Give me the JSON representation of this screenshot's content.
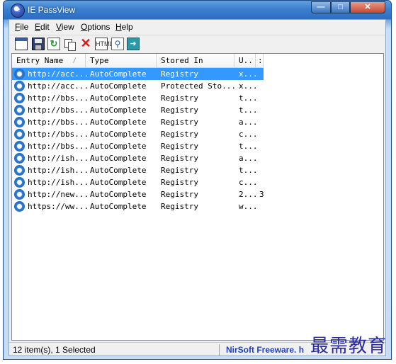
{
  "window": {
    "title": "IE PassView",
    "app_icon_text": "IE"
  },
  "menu": [
    {
      "label": "File",
      "underline": "F",
      "rest": "ile"
    },
    {
      "label": "Edit",
      "underline": "E",
      "rest": "dit"
    },
    {
      "label": "View",
      "underline": "V",
      "rest": "iew"
    },
    {
      "label": "Options",
      "underline": "O",
      "rest": "ptions"
    },
    {
      "label": "Help",
      "underline": "H",
      "rest": "elp"
    }
  ],
  "toolbar": {
    "icons": [
      "properties-icon",
      "save-icon",
      "refresh-icon",
      "copy-icon",
      "delete-icon",
      "html-report-icon",
      "find-icon",
      "exit-icon"
    ],
    "html_text": "HTML"
  },
  "table": {
    "columns": [
      "Entry Name",
      "Type",
      "Stored In",
      "U..",
      ":"
    ],
    "sort_indicator": "/",
    "rows": [
      {
        "entry": "http://acc...",
        "type": "AutoComplete",
        "stored": "Registry",
        "user": "x...",
        "extra": "",
        "selected": true
      },
      {
        "entry": "http://acc...",
        "type": "AutoComplete",
        "stored": "Protected Sto...",
        "user": "x...",
        "extra": "",
        "selected": false
      },
      {
        "entry": "http://bbs...",
        "type": "AutoComplete",
        "stored": "Registry",
        "user": "t...",
        "extra": "",
        "selected": false
      },
      {
        "entry": "http://bbs...",
        "type": "AutoComplete",
        "stored": "Registry",
        "user": "t...",
        "extra": "",
        "selected": false
      },
      {
        "entry": "http://bbs...",
        "type": "AutoComplete",
        "stored": "Registry",
        "user": "a...",
        "extra": "",
        "selected": false
      },
      {
        "entry": "http://bbs...",
        "type": "AutoComplete",
        "stored": "Registry",
        "user": "c...",
        "extra": "",
        "selected": false
      },
      {
        "entry": "http://bbs...",
        "type": "AutoComplete",
        "stored": "Registry",
        "user": "t...",
        "extra": "",
        "selected": false
      },
      {
        "entry": "http://ish...",
        "type": "AutoComplete",
        "stored": "Registry",
        "user": "a...",
        "extra": "",
        "selected": false
      },
      {
        "entry": "http://ish...",
        "type": "AutoComplete",
        "stored": "Registry",
        "user": "t...",
        "extra": "",
        "selected": false
      },
      {
        "entry": "http://ish...",
        "type": "AutoComplete",
        "stored": "Registry",
        "user": "c...",
        "extra": "",
        "selected": false
      },
      {
        "entry": "http://new...",
        "type": "AutoComplete",
        "stored": "Registry",
        "user": "2...",
        "extra": "3",
        "selected": false
      },
      {
        "entry": "https://ww...",
        "type": "AutoComplete",
        "stored": "Registry",
        "user": "w...",
        "extra": "",
        "selected": false
      }
    ]
  },
  "status": {
    "count_text": "12 item(s), 1 Selected",
    "credit_text": "NirSoft Freeware. h"
  },
  "watermark": "最需教育",
  "colors": {
    "selection": "#3399ff",
    "credit": "#1f3fbf",
    "watermark": "#2a2aa8"
  }
}
